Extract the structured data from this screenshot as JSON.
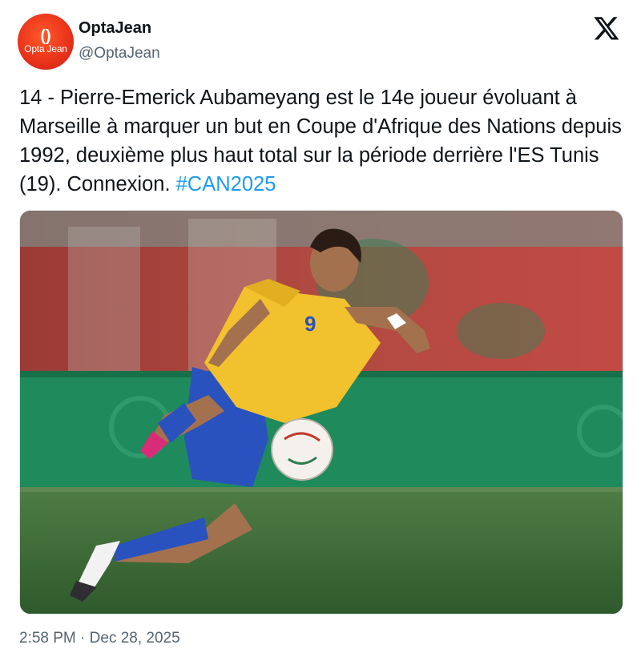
{
  "author": {
    "display_name": "OptaJean",
    "handle": "@OptaJean",
    "avatar_logo_text": "Opta Jean"
  },
  "tweet": {
    "text_main": "14 - Pierre-Emerick Aubameyang est le 14e joueur évoluant à Marseille à marquer un but en Coupe d'Afrique des Nations depuis 1992, deuxième plus haut total sur la période derrière l'ES Tunis (19). Connexion.",
    "hashtag": "#CAN2025",
    "jersey_number": "9",
    "time": "2:58 PM",
    "separator": "·",
    "date": "Dec 28, 2025"
  },
  "icons": {
    "platform": "x-logo-icon"
  },
  "colors": {
    "link": "#1d9bf0",
    "text": "#0f1419",
    "muted": "#536471",
    "avatar": "#e8311a",
    "jersey": "#f2c12e",
    "shorts": "#2a52be"
  }
}
